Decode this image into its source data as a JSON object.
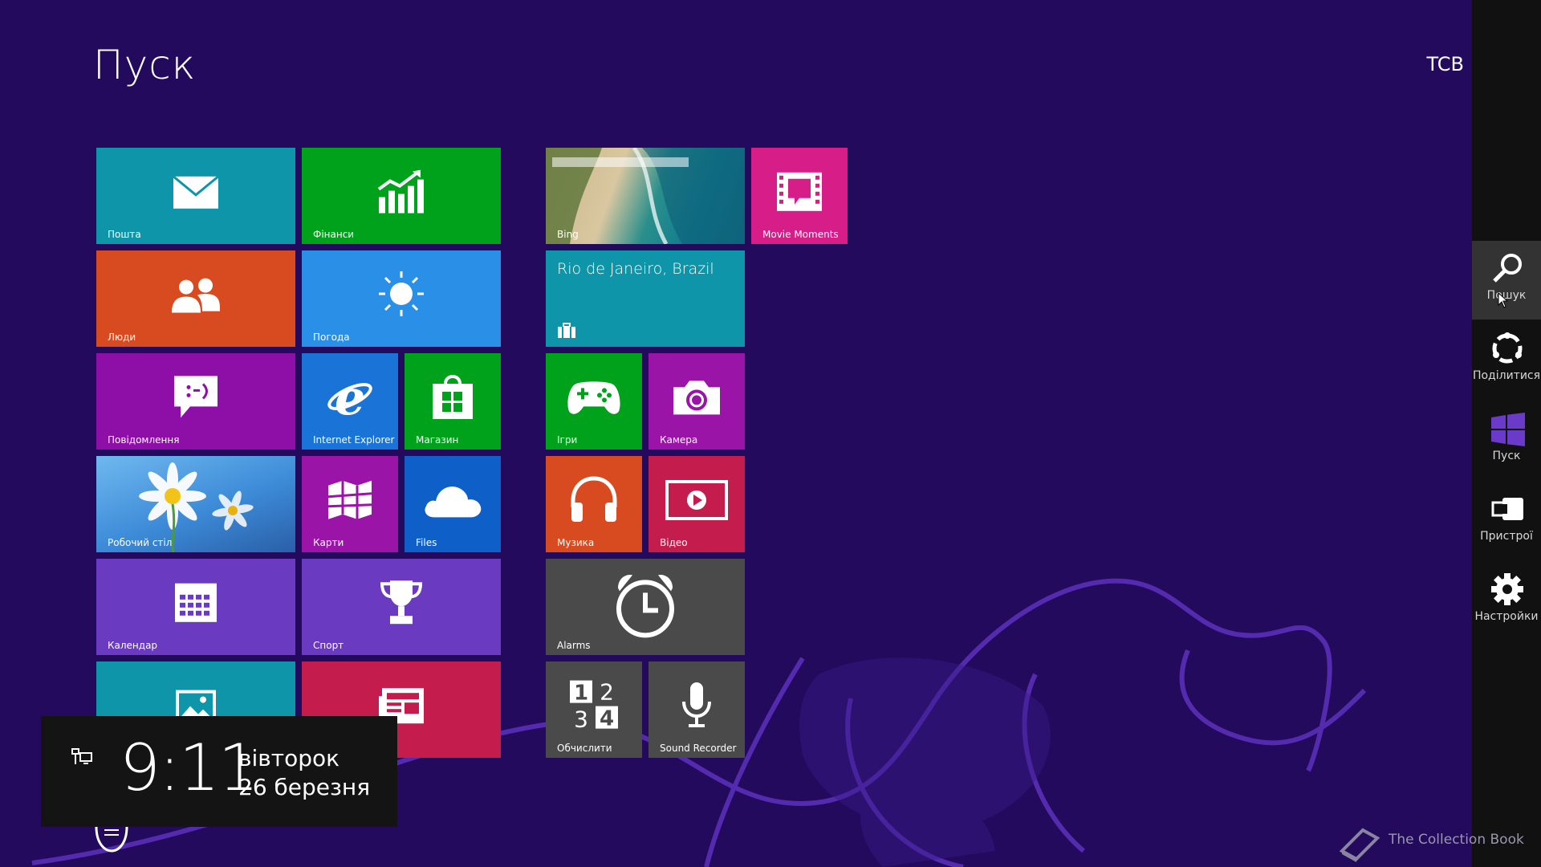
{
  "screen": {
    "title": "Пуск",
    "user": "TCB"
  },
  "tiles": {
    "mail": {
      "label": "Пошта",
      "color": "#0f95a9"
    },
    "finance": {
      "label": "Фінанси",
      "color": "#00a21c"
    },
    "people": {
      "label": "Люди",
      "color": "#d84b20"
    },
    "weather": {
      "label": "Погода",
      "color": "#2a8fe6"
    },
    "messaging": {
      "label": "Повідомлення",
      "color": "#8e0fa8"
    },
    "ie": {
      "label": "Internet Explorer",
      "color": "#1a73d6"
    },
    "store": {
      "label": "Магазин",
      "color": "#00a21c"
    },
    "desktop": {
      "label": "Робочий стіл",
      "color": "#3d8bd8"
    },
    "maps": {
      "label": "Карти",
      "color": "#9a14a8"
    },
    "files": {
      "label": "Files",
      "color": "#0f5fc8"
    },
    "calendar": {
      "label": "Календар",
      "color": "#6a3ac0"
    },
    "sport": {
      "label": "Спорт",
      "color": "#6a3ac0"
    },
    "photos": {
      "label": "Фотографії",
      "color": "#0f95a9"
    },
    "news": {
      "label": "Новини",
      "color": "#c41c4d"
    },
    "bing": {
      "label": "Bing"
    },
    "movie_moments": {
      "label": "Movie Moments",
      "color": "#d71d88"
    },
    "travel": {
      "label": "Rio de Janeiro, Brazil",
      "color": "#0f95a9"
    },
    "games": {
      "label": "Ігри",
      "color": "#00a21c"
    },
    "camera": {
      "label": "Камера",
      "color": "#9a14a8"
    },
    "music": {
      "label": "Музика",
      "color": "#d84b20"
    },
    "video": {
      "label": "Відео",
      "color": "#c41c4d"
    },
    "alarms": {
      "label": "Alarms",
      "color": "#4a4a4a"
    },
    "calculator": {
      "label": "Обчислити",
      "color": "#4a4a4a"
    },
    "sound_recorder": {
      "label": "Sound Recorder",
      "color": "#4a4a4a"
    }
  },
  "charms": {
    "search": "Пошук",
    "share": "Поділитися",
    "start": "Пуск",
    "devices": "Пристрої",
    "settings": "Настройки"
  },
  "clock": {
    "time": "9:11",
    "day": "вівторок",
    "date": "26 березня"
  },
  "watermark": "The Collection Book"
}
